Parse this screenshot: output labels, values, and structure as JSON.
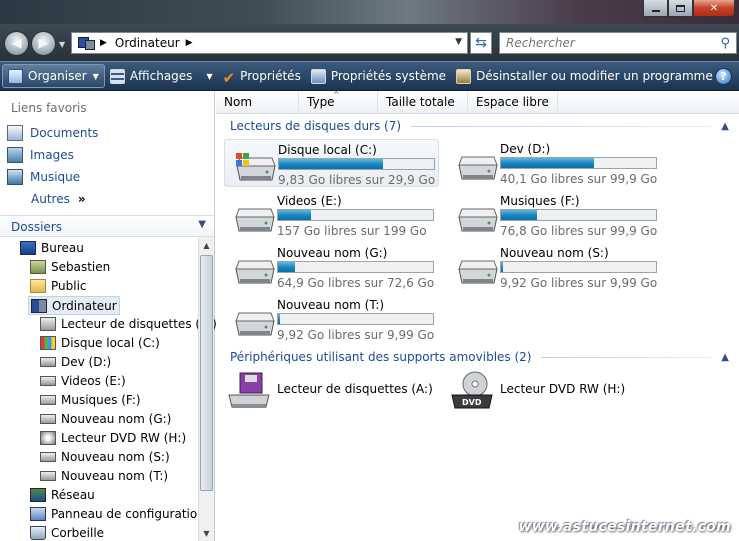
{
  "address": {
    "crumb": "Ordinateur",
    "search_placeholder": "Rechercher"
  },
  "commands": {
    "organize": "Organiser",
    "views": "Affichages",
    "properties": "Propriétés",
    "system_properties": "Propriétés système",
    "uninstall": "Désinstaller ou modifier un programme"
  },
  "favorites": {
    "title": "Liens favoris",
    "items": [
      "Documents",
      "Images",
      "Musique",
      "Autres"
    ]
  },
  "folders": {
    "title": "Dossiers",
    "tree": [
      "Bureau",
      "Sebastien",
      "Public",
      "Ordinateur",
      "Lecteur de disquettes (A:)",
      "Disque local (C:)",
      "Dev (D:)",
      "Videos (E:)",
      "Musiques (F:)",
      "Nouveau nom (G:)",
      "Lecteur DVD RW (H:)",
      "Nouveau nom (S:)",
      "Nouveau nom (T:)",
      "Réseau",
      "Panneau de configuration",
      "Corbeille"
    ]
  },
  "columns": [
    "Nom",
    "Type",
    "Taille totale",
    "Espace libre"
  ],
  "groups": {
    "hard_drives": "Lecteurs de disques durs (7)",
    "removable": "Périphériques utilisant des supports amovibles (2)"
  },
  "drives": [
    {
      "name": "Disque local (C:)",
      "free": "9,83 Go libres sur 29,9 Go",
      "used_fraction": 0.67
    },
    {
      "name": "Dev (D:)",
      "free": "40,1 Go libres sur 99,9 Go",
      "used_fraction": 0.6
    },
    {
      "name": "Videos (E:)",
      "free": "157 Go libres sur 199 Go",
      "used_fraction": 0.21
    },
    {
      "name": "Musiques (F:)",
      "free": "76,8 Go libres sur 99,9 Go",
      "used_fraction": 0.23
    },
    {
      "name": "Nouveau nom (G:)",
      "free": "64,9 Go libres sur 72,6 Go",
      "used_fraction": 0.11
    },
    {
      "name": "Nouveau nom (S:)",
      "free": "9,92 Go libres sur 9,99 Go",
      "used_fraction": 0.01
    },
    {
      "name": "Nouveau nom (T:)",
      "free": "9,92 Go libres sur 9,99 Go",
      "used_fraction": 0.01
    }
  ],
  "removable": [
    {
      "name": "Lecteur de disquettes (A:)"
    },
    {
      "name": "Lecteur DVD RW (H:)"
    }
  ],
  "watermark": "www.astucesinternet.com"
}
